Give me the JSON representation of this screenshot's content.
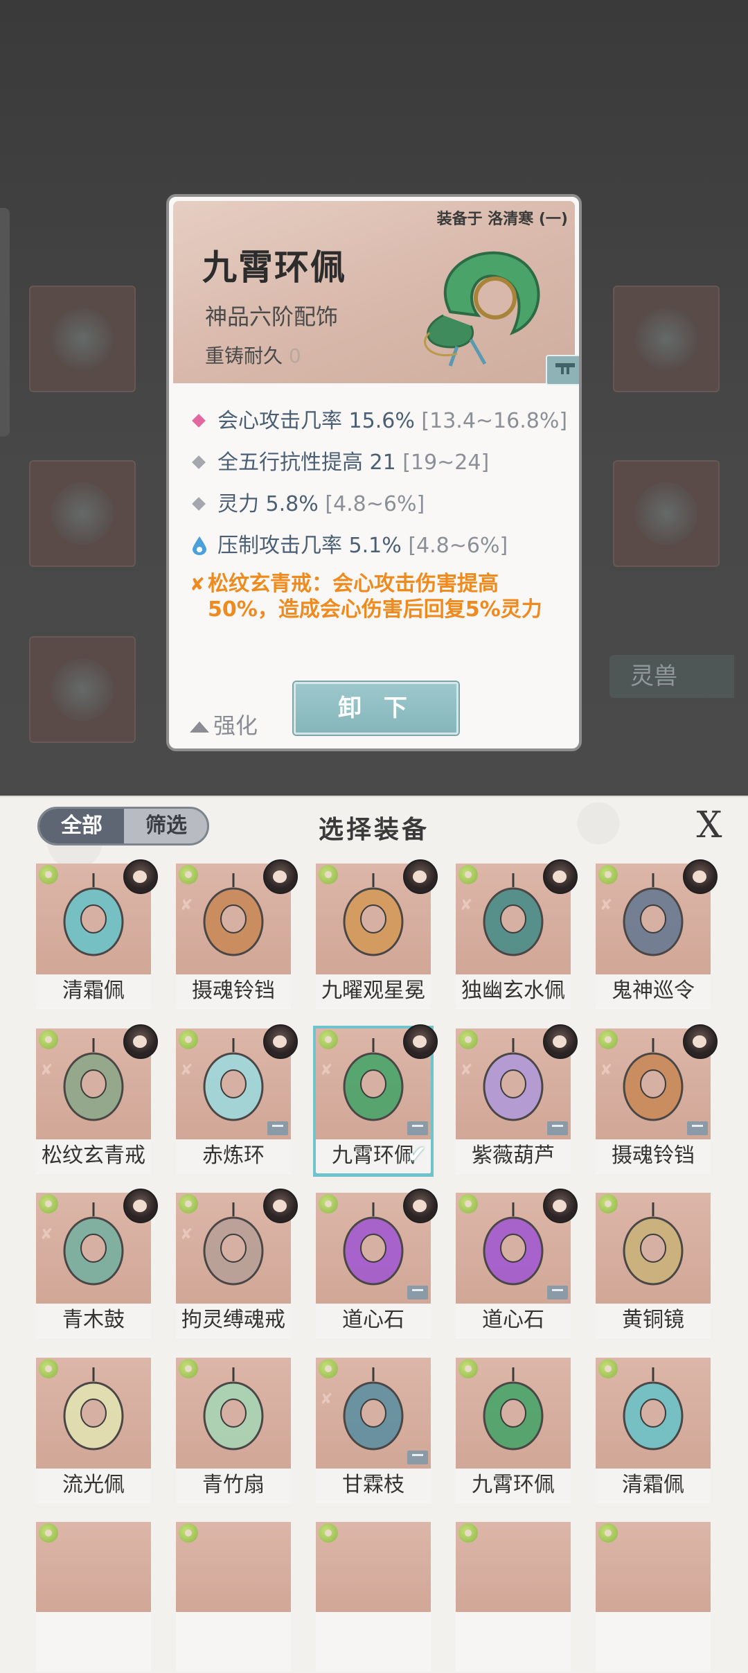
{
  "tooltip": {
    "equipped_on": "装备于 洛清寒 (一)",
    "name": "九霄环佩",
    "grade": "神品六阶配饰",
    "reforge_label": "重铸耐久",
    "reforge_value": "0",
    "stats": [
      {
        "icon": "pink-diamond-icon",
        "name": "会心攻击几率",
        "value": "15.6%",
        "range": "[13.4~16.8%]"
      },
      {
        "icon": "gray-diamond-icon",
        "name": "全五行抗性提高",
        "value": "21",
        "range": "[19~24]"
      },
      {
        "icon": "gray-diamond-icon",
        "name": "灵力",
        "value": "5.8%",
        "range": "[4.8~6%]"
      },
      {
        "icon": "water-drop-icon",
        "name": "压制攻击几率",
        "value": "5.1%",
        "range": "[4.8~6%]"
      }
    ],
    "set_effect": "松纹玄青戒：会心攻击伤害提高50%，造成会心伤害后回复5%灵力",
    "enhance_label": "强化",
    "unequip_label": "卸 下"
  },
  "background": {
    "tab_label": "灵兽"
  },
  "panel": {
    "tab_all": "全部",
    "tab_filter": "筛选",
    "title": "选择装备",
    "close": "X",
    "items": [
      {
        "label": "清霜佩"
      },
      {
        "label": "摄魂铃铛"
      },
      {
        "label": "九曜观星冕"
      },
      {
        "label": "独幽玄水佩"
      },
      {
        "label": "鬼神巡令"
      },
      {
        "label": "松纹玄青戒"
      },
      {
        "label": "赤炼环"
      },
      {
        "label": "九霄环佩"
      },
      {
        "label": "紫薇葫芦"
      },
      {
        "label": "摄魂铃铛"
      },
      {
        "label": "青木鼓"
      },
      {
        "label": "拘灵缚魂戒"
      },
      {
        "label": "道心石"
      },
      {
        "label": "道心石"
      },
      {
        "label": "黄铜镜"
      },
      {
        "label": "流光佩"
      },
      {
        "label": "青竹扇"
      },
      {
        "label": "甘霖枝"
      },
      {
        "label": "九霄环佩"
      },
      {
        "label": "清霜佩"
      }
    ]
  },
  "colors": {
    "accent_teal": "#86b6ba",
    "set_orange": "#ef8a1e",
    "stat_blue": "#4b5f74"
  }
}
